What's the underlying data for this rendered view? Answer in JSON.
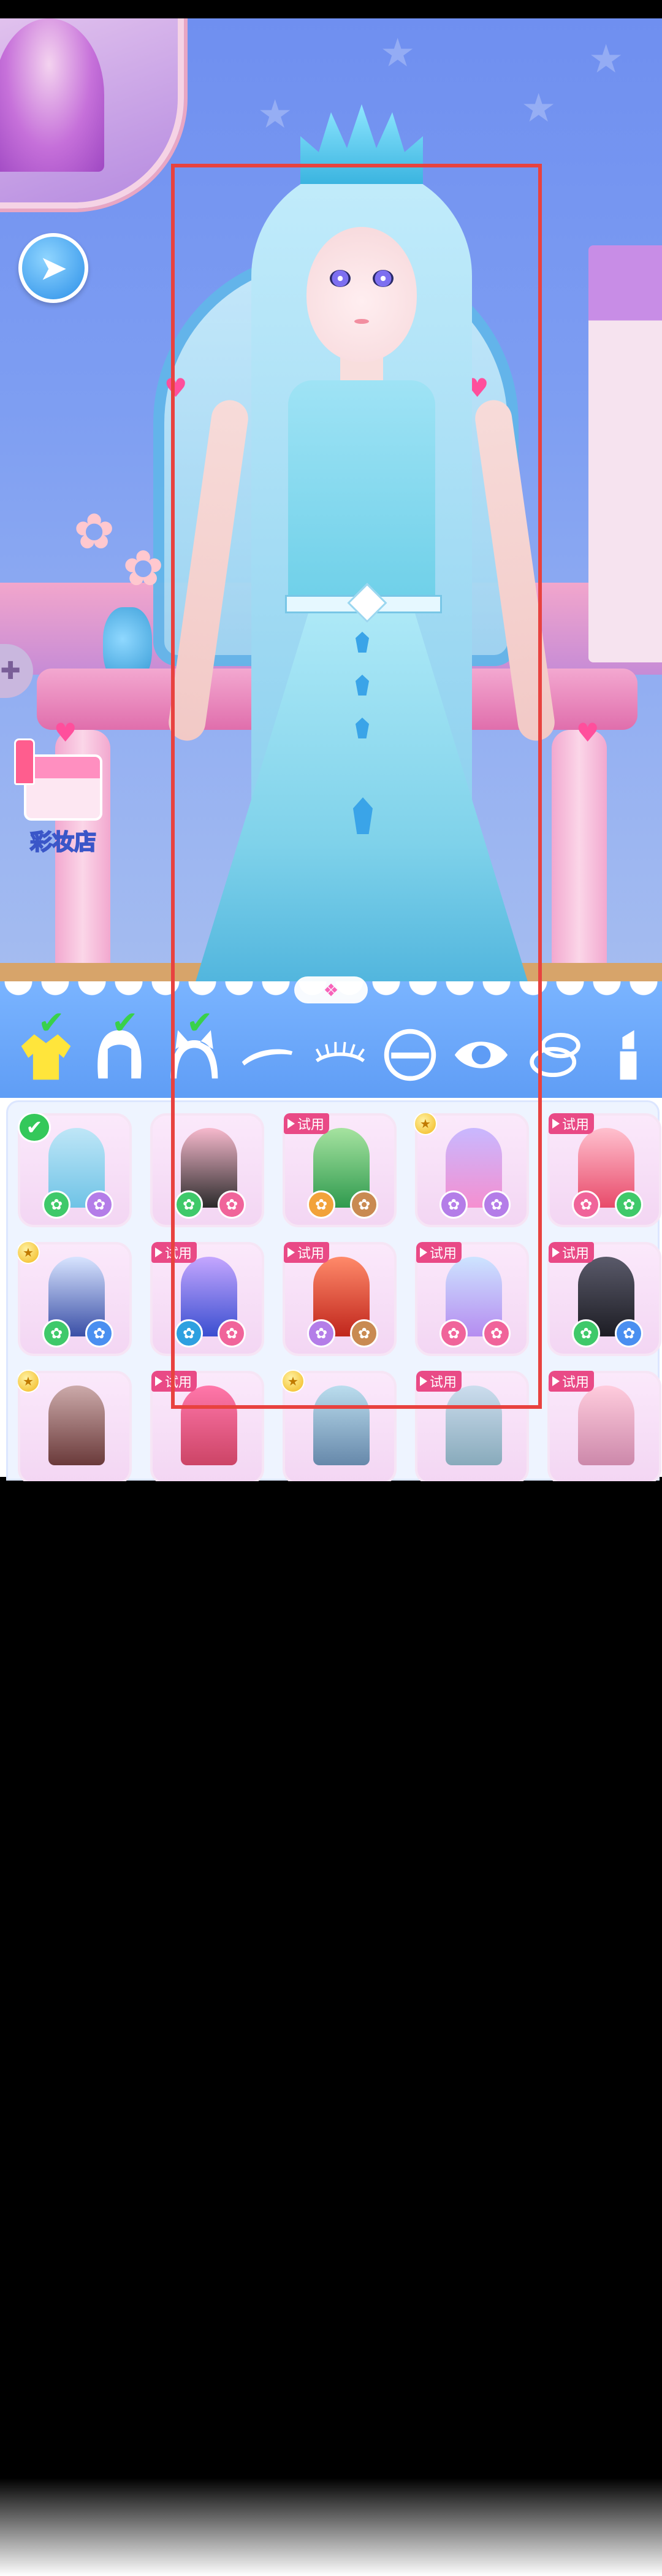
{
  "store": {
    "label": "彩妆店"
  },
  "categories": [
    {
      "id": "outfit",
      "icon": "coat-icon",
      "checked": true,
      "active": true
    },
    {
      "id": "hair",
      "icon": "hair-icon",
      "checked": true,
      "active": false
    },
    {
      "id": "headwear",
      "icon": "cat-ears-icon",
      "checked": true,
      "active": false
    },
    {
      "id": "eyebrow",
      "icon": "eyebrow-icon",
      "checked": false,
      "active": false
    },
    {
      "id": "eyelash",
      "icon": "eyelash-icon",
      "checked": false,
      "active": false
    },
    {
      "id": "eyeshadow",
      "icon": "eyeshadow-icon",
      "checked": false,
      "active": false
    },
    {
      "id": "eye",
      "icon": "eye-icon",
      "checked": false,
      "active": false
    },
    {
      "id": "blush",
      "icon": "compact-icon",
      "checked": false,
      "active": false
    },
    {
      "id": "lipstick",
      "icon": "lipstick-icon",
      "checked": false,
      "active": false
    }
  ],
  "trial_label": "试用",
  "outfits": [
    {
      "badge": "check",
      "colors": [
        "#bfe6f7",
        "#6fc3e6"
      ],
      "tags": [
        "#3fc96a",
        "#b47de8"
      ]
    },
    {
      "badge": "none",
      "colors": [
        "#f7b9cd",
        "#2b2b2b"
      ],
      "tags": [
        "#3fc96a",
        "#f0649a"
      ]
    },
    {
      "badge": "trial",
      "colors": [
        "#a6e3a0",
        "#2f9a4e"
      ],
      "tags": [
        "#f2a23a",
        "#c98a52"
      ]
    },
    {
      "badge": "coin",
      "colors": [
        "#c8b8ff",
        "#f58fd0"
      ],
      "tags": [
        "#b47de8",
        "#b47de8"
      ]
    },
    {
      "badge": "trial",
      "colors": [
        "#ffc1cf",
        "#e84a6a"
      ],
      "tags": [
        "#f0649a",
        "#3fc96a"
      ]
    },
    {
      "badge": "coin",
      "colors": [
        "#d8e4ff",
        "#3a4fa6"
      ],
      "tags": [
        "#3fc96a",
        "#4a8ff0"
      ]
    },
    {
      "badge": "trial",
      "colors": [
        "#c5a6ff",
        "#3a4fd0"
      ],
      "tags": [
        "#2ea0e0",
        "#f0649a"
      ]
    },
    {
      "badge": "trial",
      "colors": [
        "#ff8a6a",
        "#c0261c"
      ],
      "tags": [
        "#b47de8",
        "#c98a52"
      ]
    },
    {
      "badge": "trial",
      "colors": [
        "#cde4ff",
        "#b58cf0"
      ],
      "tags": [
        "#f0649a",
        "#f0649a"
      ]
    },
    {
      "badge": "trial",
      "colors": [
        "#5a5a6a",
        "#1d1d24"
      ],
      "tags": [
        "#3fc96a",
        "#4a8ff0"
      ]
    },
    {
      "badge": "coin",
      "colors": [
        "#caa",
        "#6a3a3a"
      ],
      "tags": []
    },
    {
      "badge": "trial",
      "colors": [
        "#f7a",
        "#c46"
      ],
      "tags": []
    },
    {
      "badge": "coin",
      "colors": [
        "#bde",
        "#68a"
      ],
      "tags": []
    },
    {
      "badge": "trial",
      "colors": [
        "#cde",
        "#8ab"
      ],
      "tags": []
    },
    {
      "badge": "trial",
      "colors": [
        "#fcd",
        "#c8a"
      ],
      "tags": []
    }
  ]
}
